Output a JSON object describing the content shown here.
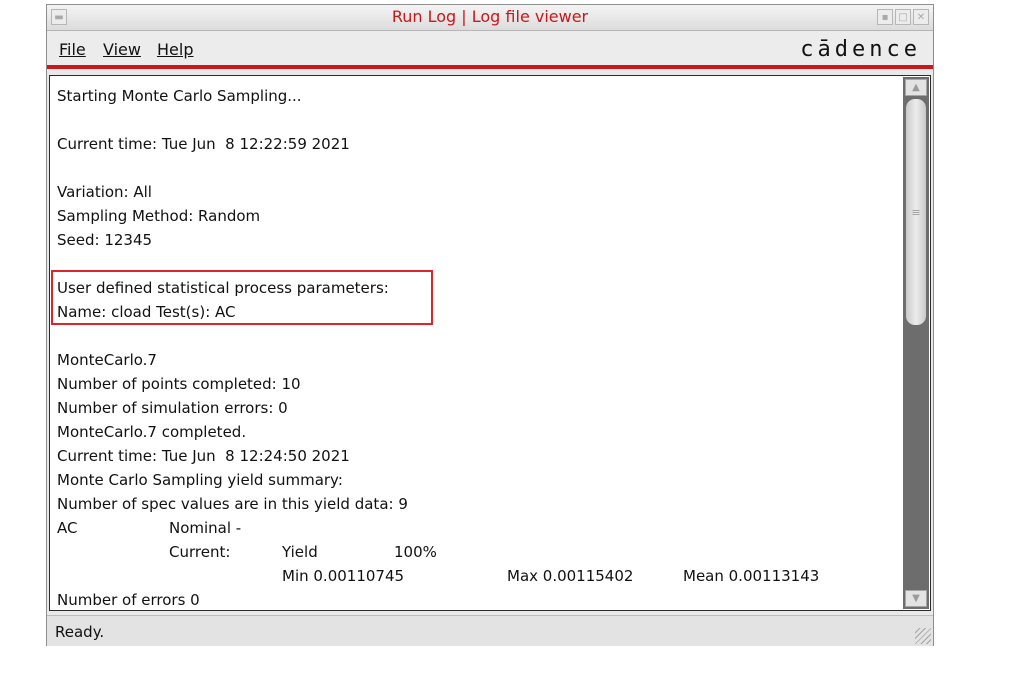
{
  "window": {
    "title": "Run Log | Log file viewer"
  },
  "titlebar_buttons": {
    "system": "▬",
    "minimize": "▪",
    "maximize": "□",
    "close": "✕"
  },
  "menu": {
    "file": "File",
    "view": "View",
    "help": "Help"
  },
  "logo": "cādence",
  "log": {
    "line_starting": "Starting Monte Carlo Sampling...",
    "line_time1": "Current time: Tue Jun  8 12:22:59 2021",
    "line_variation": "Variation: All",
    "line_method": "Sampling Method: Random",
    "line_seed": "Seed: 12345",
    "line_user_params": "User defined statistical process parameters:",
    "line_name": "Name: cload Test(s): AC",
    "line_mc7": "MonteCarlo.7",
    "line_points": "Number of points completed: 10",
    "line_sim_errors": "Number of simulation errors: 0",
    "line_mc7_done": "MonteCarlo.7 completed.",
    "line_time2": "Current time: Tue Jun  8 12:24:50 2021",
    "line_yield_summary": "Monte Carlo Sampling yield summary:",
    "line_spec_values": "Number of spec values are in this yield data: 9",
    "table": {
      "test": "AC",
      "nominal": "Nominal -",
      "current": "Current:",
      "yield_label": "Yield",
      "yield_value": "100%",
      "min": "Min 0.00110745",
      "max": "Max 0.00115402",
      "mean": "Mean 0.00113143"
    },
    "line_errors": "Number of errors 0"
  },
  "status": "Ready.",
  "colors": {
    "accent_red": "#c8181c",
    "highlight_box": "#d9262a"
  }
}
